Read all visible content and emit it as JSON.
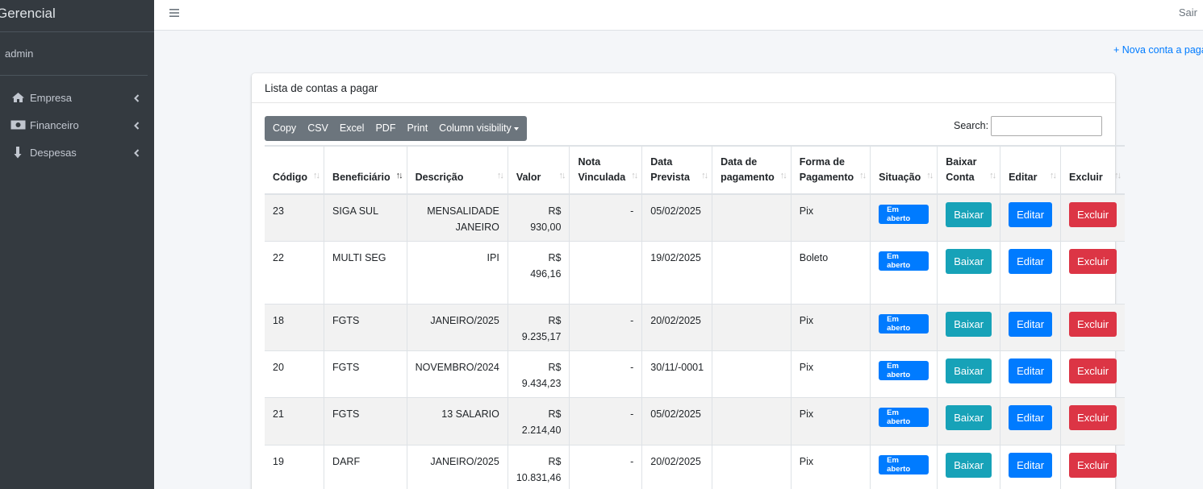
{
  "sidebar": {
    "brand": "Gerencial",
    "user": "admin",
    "items": [
      {
        "label": "Empresa",
        "icon": "home-icon"
      },
      {
        "label": "Financeiro",
        "icon": "money-bill-icon"
      },
      {
        "label": "Despesas",
        "icon": "arrow-down-icon"
      }
    ]
  },
  "topbar": {
    "logout": "Sair"
  },
  "new_link": "+ Nova conta a pagar",
  "card": {
    "title": "Lista de contas a pagar"
  },
  "toolbar": {
    "copy": "Copy",
    "csv": "CSV",
    "excel": "Excel",
    "pdf": "PDF",
    "print": "Print",
    "colvis": "Column visibility"
  },
  "search": {
    "label": "Search:"
  },
  "table": {
    "headers": [
      "Código",
      "Beneficiário",
      "Descrição",
      "Valor",
      "Nota Vinculada",
      "Data Prevista",
      "Data de pagamento",
      "Forma de Pagamento",
      "Situação",
      "Baixar Conta",
      "Editar",
      "Excluir"
    ],
    "status_label": "Em aberto",
    "baixar_label": "Baixar",
    "editar_label": "Editar",
    "excluir_label": "Excluir",
    "rows": [
      {
        "codigo": "23",
        "beneficiario": "SIGA SUL",
        "descricao": "MENSALIDADE JANEIRO",
        "valor": "R$ 930,00",
        "nota": "-",
        "data_prevista": "05/02/2025",
        "data_pagamento": "",
        "forma": "Pix"
      },
      {
        "codigo": "22",
        "beneficiario": "MULTI SEG",
        "descricao": "IPI",
        "valor": "R$ 496,16",
        "nota": "",
        "data_prevista": "19/02/2025",
        "data_pagamento": "",
        "forma": "Boleto"
      },
      {
        "codigo": "18",
        "beneficiario": "FGTS",
        "descricao": "JANEIRO/2025",
        "valor": "R$ 9.235,17",
        "nota": "-",
        "data_prevista": "20/02/2025",
        "data_pagamento": "",
        "forma": "Pix"
      },
      {
        "codigo": "20",
        "beneficiario": "FGTS",
        "descricao": "NOVEMBRO/2024",
        "valor": "R$ 9.434,23",
        "nota": "-",
        "data_prevista": "30/11/-0001",
        "data_pagamento": "",
        "forma": "Pix"
      },
      {
        "codigo": "21",
        "beneficiario": "FGTS",
        "descricao": "13 SALARIO",
        "valor": "R$ 2.214,40",
        "nota": "-",
        "data_prevista": "05/02/2025",
        "data_pagamento": "",
        "forma": "Pix"
      },
      {
        "codigo": "19",
        "beneficiario": "DARF",
        "descricao": "JANEIRO/2025",
        "valor": "R$ 10.831,46",
        "nota": "-",
        "data_prevista": "20/02/2025",
        "data_pagamento": "",
        "forma": "Pix"
      }
    ]
  }
}
